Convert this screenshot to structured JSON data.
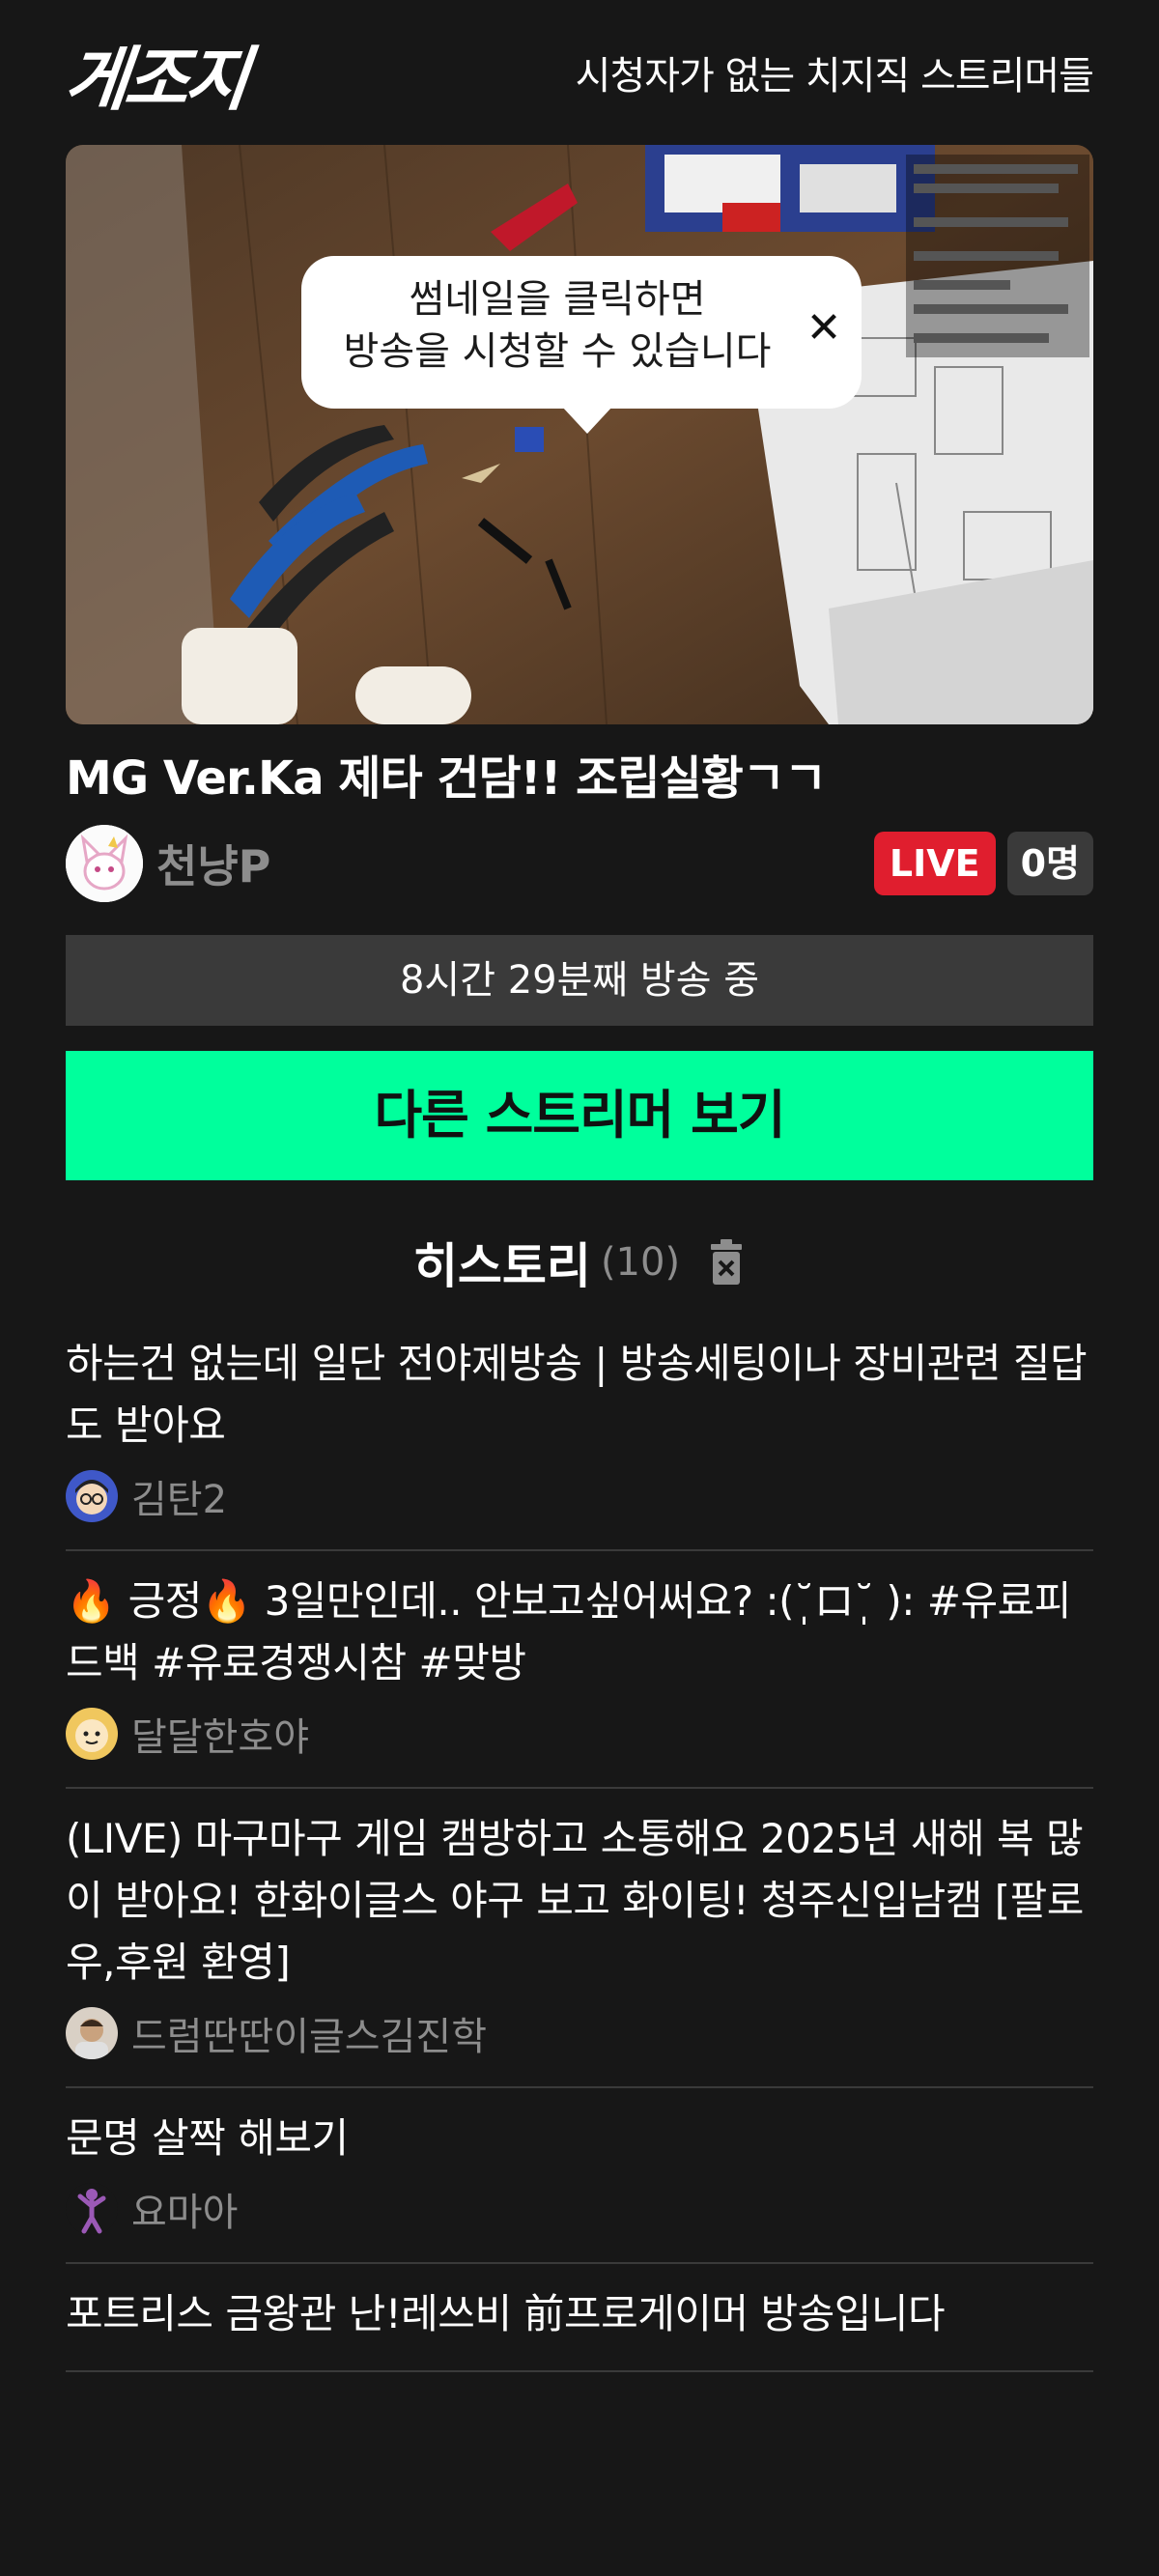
{
  "header": {
    "logo": "게조지",
    "tagline": "시청자가 없는 치지직 스트리머들"
  },
  "thumbnail": {
    "tooltip_line1": "썸네일을 클릭하면",
    "tooltip_line2": "방송을 시청할 수 있습니다",
    "close_icon": "close-icon"
  },
  "stream": {
    "title": "MG Ver.Ka 제타 건담!! 조립실황ㄱㄱ",
    "streamer": "천냥P",
    "live_label": "LIVE",
    "viewers": "0명",
    "duration": "8시간 29분째 방송 중"
  },
  "actions": {
    "other_streamer": "다른 스트리머 보기"
  },
  "history": {
    "title": "히스토리",
    "count": "(10)",
    "items": [
      {
        "title": "하는건 없는데 일단 전야제방송 | 방송세팅이나 장비관련 질답도 받아요",
        "streamer": "김탄2"
      },
      {
        "title": "🔥 긍정🔥  3일만인데.. 안보고싶어써요? :(˘̩̩̩ロ˘̩̩̩ ): #유료피드백 #유료경쟁시참 #맞방",
        "streamer": "달달한호야"
      },
      {
        "title": "(LIVE) 마구마구 게임 캠방하고 소통해요 2025년 새해 복 많이 받아요! 한화이글스 야구 보고 화이팅! 청주신입남캠 [팔로우,후원 환영]",
        "streamer": "드럼딴딴이글스김진학"
      },
      {
        "title": "문명 살짝 해보기",
        "streamer": "요마아"
      },
      {
        "title": "포트리스 금왕관 난!레쓰비 前프로게이머 방송입니다",
        "streamer": ""
      }
    ]
  },
  "colors": {
    "background": "#171717",
    "accent_green": "#00ff9c",
    "live_red": "#e01e2e",
    "muted_gray": "#8d8d8d",
    "panel_gray": "#3a3a3a"
  }
}
